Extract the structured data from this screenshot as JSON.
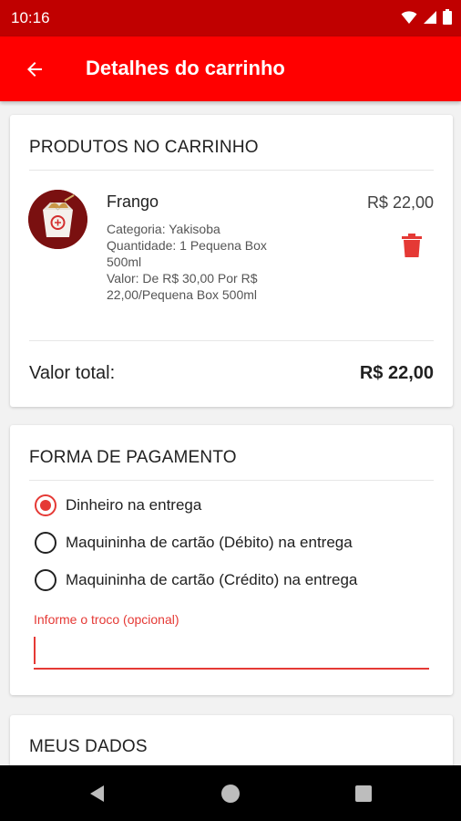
{
  "status_bar": {
    "time": "10:16",
    "icons": [
      "wifi-icon",
      "signal-icon",
      "battery-icon"
    ]
  },
  "app_bar": {
    "back_icon": "arrow-back-icon",
    "title": "Detalhes do carrinho"
  },
  "cart": {
    "section_title": "PRODUTOS NO CARRINHO",
    "items": [
      {
        "name": "Frango",
        "price": "R$ 22,00",
        "category": "Categoria: Yakisoba",
        "quantity": "Quantidade: 1 Pequena Box 500ml",
        "value": "Valor: De R$ 30,00 Por R$ 22,00/Pequena Box 500ml",
        "delete_icon": "trash-icon"
      }
    ],
    "total_label": "Valor total:",
    "total_value": "R$ 22,00"
  },
  "payment": {
    "section_title": "FORMA DE PAGAMENTO",
    "options": [
      {
        "label": "Dinheiro na entrega",
        "selected": true
      },
      {
        "label": "Maquininha de cartão (Débito) na entrega",
        "selected": false
      },
      {
        "label": "Maquininha de cartão (Crédito) na entrega",
        "selected": false
      }
    ],
    "troco_label": "Informe o troco (opcional)",
    "troco_value": ""
  },
  "my_data": {
    "section_title": "MEUS DADOS"
  },
  "nav_bar": {
    "icons": [
      "back-triangle-icon",
      "home-circle-icon",
      "recents-square-icon"
    ]
  },
  "colors": {
    "status_bar": "#c00000",
    "app_bar": "#ff0000",
    "accent": "#e53935"
  }
}
